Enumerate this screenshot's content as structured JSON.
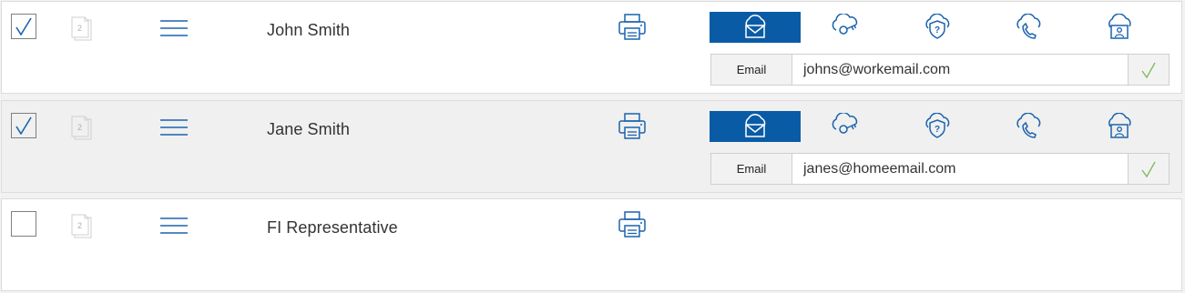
{
  "recipients": [
    {
      "name": "John Smith",
      "checked": true,
      "page_count": "2",
      "delivery": {
        "label": "Email",
        "value": "johns@workemail.com",
        "placeholder": "",
        "status": "valid"
      }
    },
    {
      "name": "Jane Smith",
      "checked": true,
      "page_count": "2",
      "delivery": {
        "label": "Email",
        "value": "janes@homeemail.com",
        "placeholder": "",
        "status": "valid"
      }
    },
    {
      "name": "FI Representative",
      "checked": false,
      "page_count": "2"
    }
  ],
  "delivery_methods": [
    "cloud-email-icon",
    "cloud-key-icon",
    "cloud-shield-question-icon",
    "cloud-phone-icon",
    "cloud-id-card-icon"
  ],
  "colors": {
    "accent": "#0a5ba6",
    "icon_blue": "#1a63ad",
    "check_green": "#7fb85b",
    "row_grey": "#f0f0f0"
  }
}
